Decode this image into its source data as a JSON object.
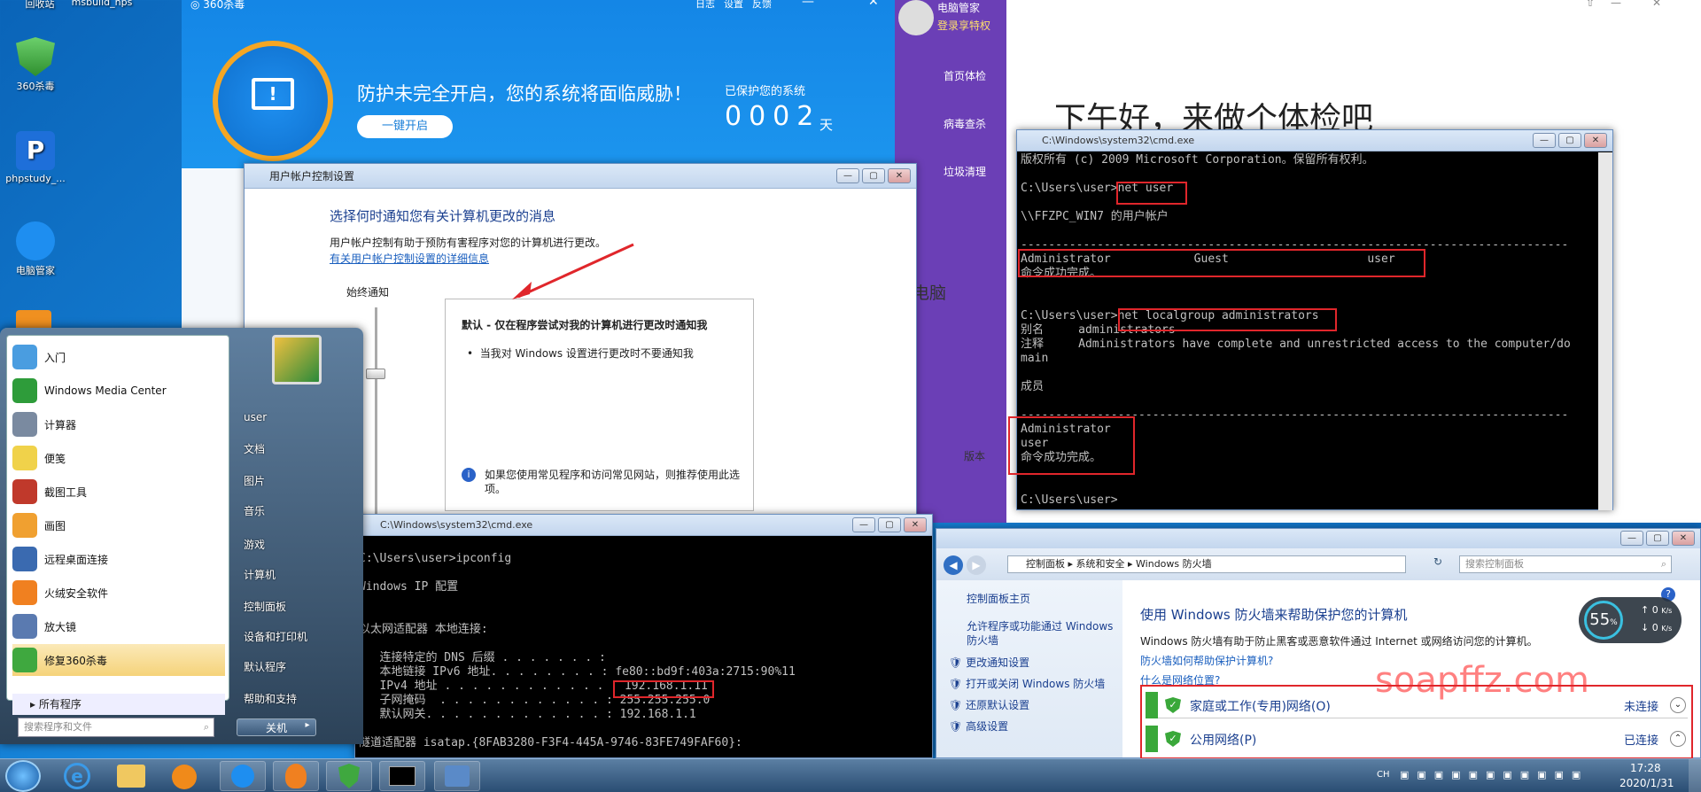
{
  "desktop": {
    "top_labels": [
      "回收站",
      "msbuild_nps"
    ],
    "icons": [
      {
        "label": "360杀毒",
        "color": "#3fa83f"
      },
      {
        "label": "phpstudy_...",
        "color": "#1e6fd9"
      },
      {
        "label": "电脑管家",
        "color": "#1e8ef0"
      }
    ]
  },
  "win360": {
    "title": "360杀毒",
    "header_links": [
      "日志",
      "设置",
      "反馈"
    ],
    "message": "防护未完全开启，您的系统将面临威胁！",
    "button": "一键开启",
    "protected_label": "已保护您的系统",
    "days": "0002",
    "days_unit": "天"
  },
  "pcmanager": {
    "name": "电脑管家",
    "login": "登录享特权",
    "menu": [
      "首页体检",
      "病毒查杀",
      "垃圾清理"
    ],
    "greeting": "下午好，来做个体检吧",
    "fragment1": "电脑",
    "fragment2": "版本"
  },
  "uac": {
    "title": "用户帐户控制设置",
    "heading": "选择何时通知您有关计算机更改的消息",
    "desc": "用户帐户控制有助于预防有害程序对您的计算机进行更改。",
    "link": "有关用户帐户控制设置的详细信息",
    "slider_label": "始终通知",
    "box_title": "默认 - 仅在程序尝试对我的计算机进行更改时通知我",
    "bullet": "当我对 Windows 设置进行更改时不要通知我",
    "note": "如果您使用常见程序和访问常见网站，则推荐使用此选项。"
  },
  "cmd1": {
    "title": "C:\\Windows\\system32\\cmd.exe",
    "lines": [
      "版权所有 (c) 2009 Microsoft Corporation。保留所有权利。",
      "",
      "C:\\Users\\user>net user",
      "",
      "\\\\FFZPC_WIN7 的用户帐户",
      "",
      "-------------------------------------------------------------------------------",
      "Administrator            Guest                    user",
      "命令成功完成。",
      "",
      "",
      "C:\\Users\\user>net localgroup administrators",
      "别名     administrators",
      "注释     Administrators have complete and unrestricted access to the computer/do",
      "main",
      "",
      "成员",
      "",
      "-------------------------------------------------------------------------------",
      "Administrator",
      "user",
      "命令成功完成。",
      "",
      "",
      "C:\\Users\\user>"
    ]
  },
  "cmd2": {
    "title": "C:\\Windows\\system32\\cmd.exe",
    "lines": [
      "",
      "C:\\Users\\user>ipconfig",
      "",
      "Windows IP 配置",
      "",
      "",
      "以太网适配器 本地连接:",
      "",
      "   连接特定的 DNS 后缀 . . . . . . . :",
      "   本地链接 IPv6 地址. . . . . . . . : fe80::bd9f:403a:2715:90%11",
      "   IPv4 地址 . . . . . . . . . . . . : 192.168.1.11",
      "   子网掩码  . . . . . . . . . . . . : 255.255.255.0",
      "   默认网关. . . . . . . . . . . . . : 192.168.1.1",
      "",
      "隧道适配器 isatap.{8FAB3280-F3F4-445A-9746-83FE749FAF60}:"
    ]
  },
  "startmenu": {
    "left_items": [
      "入门",
      "Windows Media Center",
      "计算器",
      "便笺",
      "截图工具",
      "画图",
      "远程桌面连接",
      "火绒安全软件",
      "放大镜",
      "修复360杀毒"
    ],
    "left_colors": [
      "#4a9de0",
      "#2e9c3a",
      "#7a8aa0",
      "#f0d24a",
      "#c0392b",
      "#f0a030",
      "#3a6ab0",
      "#f08020",
      "#5a7ab0",
      "#3fa83f"
    ],
    "all_programs": "所有程序",
    "search_placeholder": "搜索程序和文件",
    "right_items": [
      "user",
      "文档",
      "图片",
      "音乐",
      "游戏",
      "计算机",
      "控制面板",
      "设备和打印机",
      "默认程序",
      "帮助和支持"
    ],
    "shutdown": "关机"
  },
  "firewall": {
    "breadcrumb": [
      "控制面板",
      "系统和安全",
      "Windows 防火墙"
    ],
    "search_placeholder": "搜索控制面板",
    "side_home": "控制面板主页",
    "side_links": [
      "允许程序或功能通过 Windows 防火墙",
      "更改通知设置",
      "打开或关闭 Windows 防火墙",
      "还原默认设置",
      "高级设置"
    ],
    "heading": "使用 Windows 防火墙来帮助保护您的计算机",
    "desc": "Windows 防火墙有助于防止黑客或恶意软件通过 Internet 或网络访问您的计算机。",
    "link1": "防火墙如何帮助保护计算机?",
    "link2": "什么是网络位置?",
    "networks": [
      {
        "name": "家庭或工作(专用)网络(O)",
        "status": "未连接"
      },
      {
        "name": "公用网络(P)",
        "status": "已连接"
      }
    ],
    "watermark": "soapffz.com"
  },
  "speed_widget": {
    "percent": "55",
    "unit": "%",
    "up": "0",
    "down": "0",
    "speed_unit": "K/s"
  },
  "taskbar": {
    "lang": "CH",
    "time": "17:28",
    "date": "2020/1/31"
  },
  "colors": {
    "accent_red": "#e0262b",
    "watermark": "#ff6b6b"
  }
}
